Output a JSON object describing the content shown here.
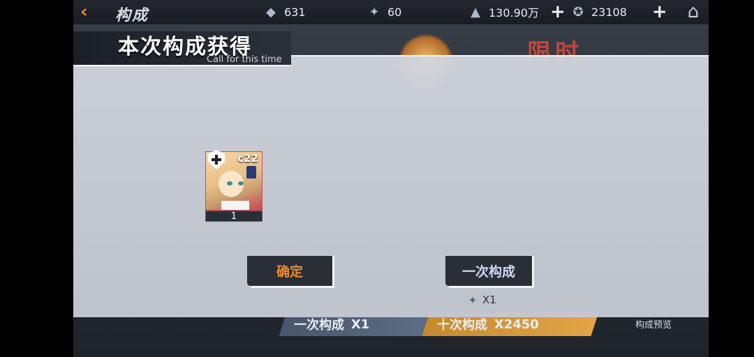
{
  "topbar": {
    "title": "构成",
    "resources": [
      {
        "icon": "diamond-icon",
        "value": "631"
      },
      {
        "icon": "core-icon",
        "value": "60"
      },
      {
        "icon": "oil-icon",
        "value": "130.90万"
      },
      {
        "icon": "star-icon",
        "value": "23108"
      }
    ]
  },
  "background": {
    "banner_text": "限时",
    "single_btn_label": "一次构成",
    "single_btn_cost": "X1",
    "ten_btn_label": "十次构成",
    "ten_btn_cost": "X2450",
    "preview_label": "构成预览"
  },
  "modal": {
    "title": "本次构成获得",
    "subtitle": "Call for this time",
    "result": {
      "rank": "c22",
      "count": "1"
    },
    "confirm_label": "确定",
    "single_label": "一次构成",
    "cost_label": "X1"
  },
  "colors": {
    "accent_orange": "#f08a2c",
    "modal_bg": "#cbd0d8",
    "button_dark": "#2a2f37"
  }
}
